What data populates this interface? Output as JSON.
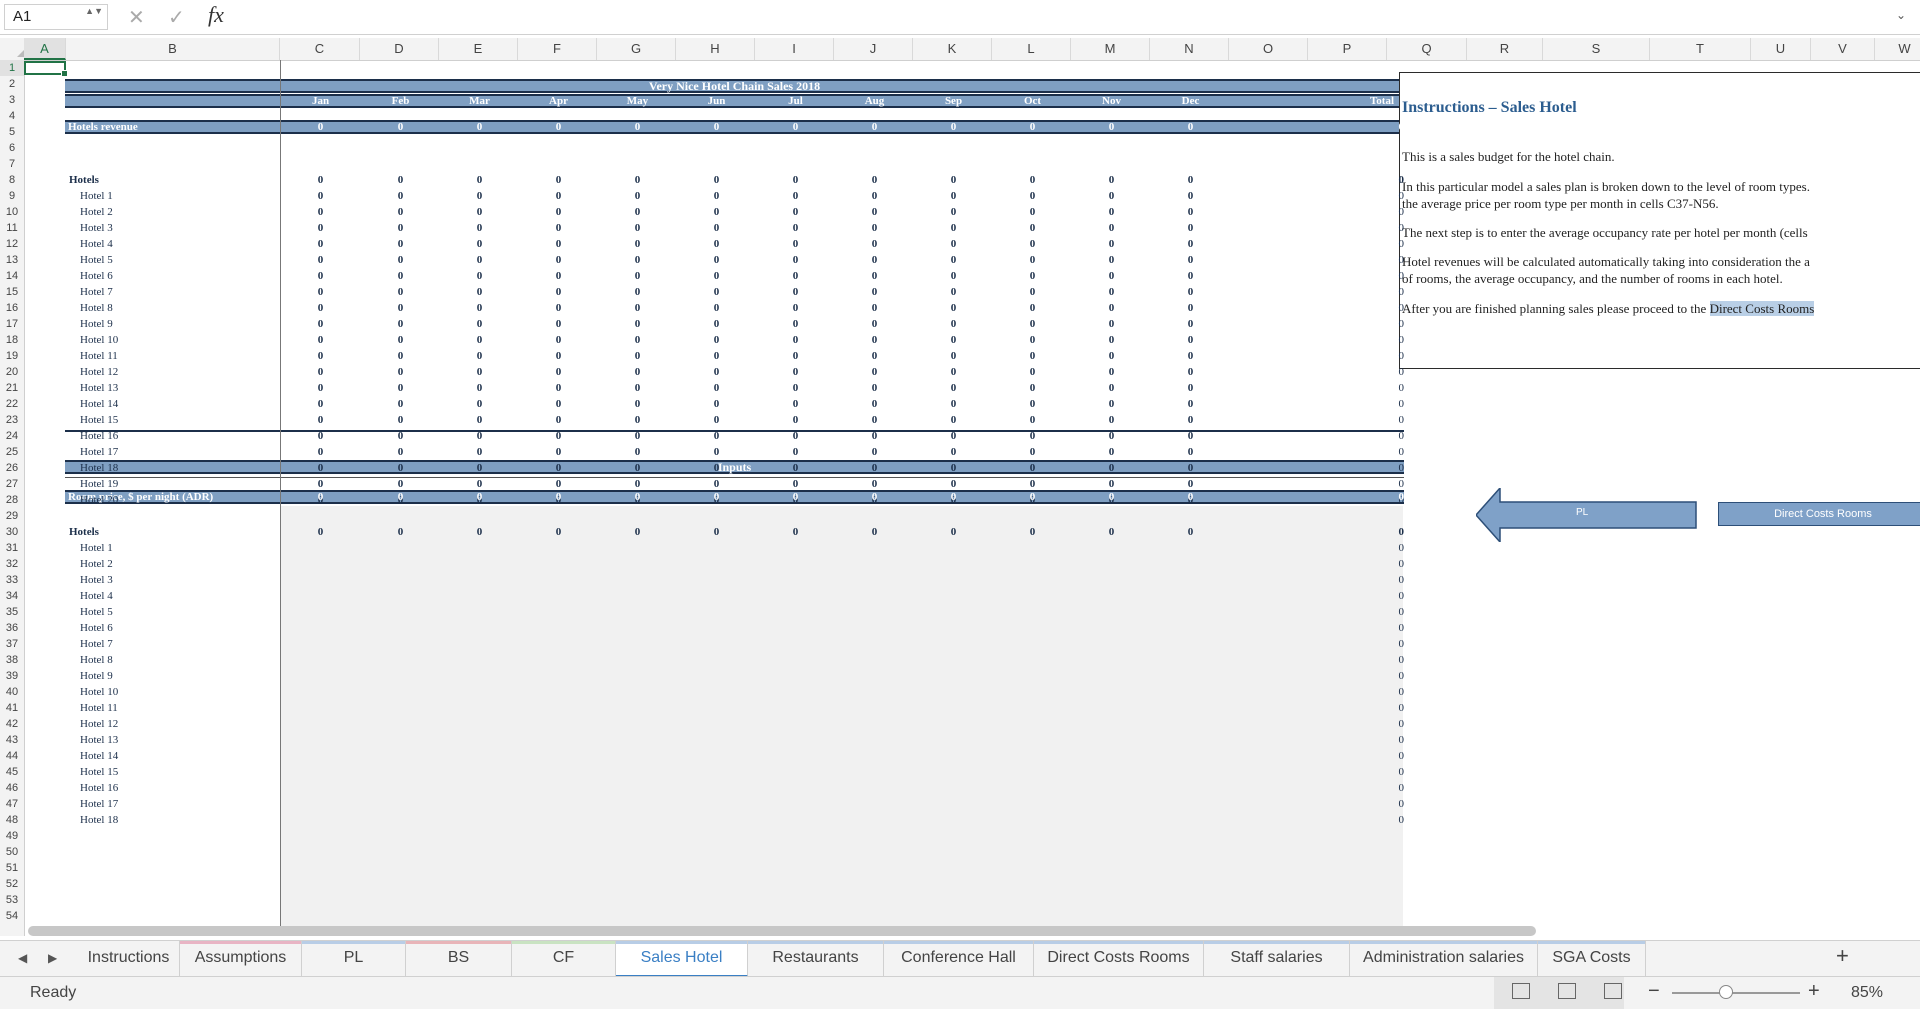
{
  "formula_bar": {
    "name_box": "A1",
    "namebox_arrows": "▲▼",
    "cancel_icon": "✕",
    "enter_icon": "✓",
    "fx_label": "fx",
    "formula": "",
    "dropdown_icon": "⌄"
  },
  "columns": [
    "A",
    "B",
    "C",
    "D",
    "E",
    "F",
    "G",
    "H",
    "I",
    "J",
    "K",
    "L",
    "M",
    "N",
    "O",
    "P",
    "Q",
    "R",
    "S",
    "T",
    "U",
    "V",
    "W"
  ],
  "rows": [
    "1",
    "2",
    "3",
    "4",
    "5",
    "6",
    "7",
    "8",
    "9",
    "10",
    "11",
    "12",
    "13",
    "14",
    "15",
    "16",
    "17",
    "18",
    "19",
    "20",
    "21",
    "22",
    "23",
    "24",
    "25",
    "26",
    "27",
    "28",
    "29",
    "30",
    "31",
    "32",
    "33",
    "34",
    "35",
    "36",
    "37",
    "38",
    "39",
    "40",
    "41",
    "42",
    "43",
    "44",
    "45",
    "46",
    "47",
    "48",
    "49",
    "50",
    "51",
    "52",
    "53",
    "54"
  ],
  "sheet": {
    "title": "Very Nice Hotel Chain Sales 2018",
    "months": [
      "Jan",
      "Feb",
      "Mar",
      "Apr",
      "May",
      "Jun",
      "Jul",
      "Aug",
      "Sep",
      "Oct",
      "Nov",
      "Dec"
    ],
    "total_label": "Total",
    "revenue_label": "Hotels revenue",
    "hotels_label": "Hotels",
    "hotels": [
      "Hotel 1",
      "Hotel 2",
      "Hotel 3",
      "Hotel 4",
      "Hotel 5",
      "Hotel 6",
      "Hotel 7",
      "Hotel 8",
      "Hotel 9",
      "Hotel 10",
      "Hotel 11",
      "Hotel 12",
      "Hotel 13",
      "Hotel 14",
      "Hotel 15",
      "Hotel 16",
      "Hotel 17",
      "Hotel 18",
      "Hotel 19",
      "Hotel 20"
    ],
    "zero": "0",
    "inputs_title": "Inputs",
    "room_price_label": "Room price, $ per night (ADR)",
    "inputs_hotels": [
      "Hotel 1",
      "Hotel 2",
      "Hotel 3",
      "Hotel 4",
      "Hotel 5",
      "Hotel 6",
      "Hotel 7",
      "Hotel 8",
      "Hotel 9",
      "Hotel 10",
      "Hotel 11",
      "Hotel 12",
      "Hotel 13",
      "Hotel 14",
      "Hotel 15",
      "Hotel 16",
      "Hotel 17",
      "Hotel 18"
    ]
  },
  "instructions": {
    "title": "Instructions – Sales Hotel",
    "p1": "This is a sales budget for the hotel chain.",
    "p2a": "In this particular model a sales plan is broken down to the level of room types.",
    "p2b": "the average price per room type per month in cells C37-N56.",
    "p3": "The next step is to enter the average occupancy rate per hotel per month (cells",
    "p4a": "Hotel revenues will be calculated automatically taking into consideration the a",
    "p4b": "of rooms, the average occupancy, and the number of rooms in each hotel.",
    "p5_pre": "After you are finished planning sales please proceed to the ",
    "p5_link": "Direct Costs Rooms"
  },
  "nav_buttons": {
    "pl": "PL",
    "direct_costs": "Direct Costs Rooms"
  },
  "tabs": [
    {
      "label": "Instructions",
      "stripe": ""
    },
    {
      "label": "Assumptions",
      "stripe": "#e8b4c4"
    },
    {
      "label": "PL",
      "stripe": "#b8cde6"
    },
    {
      "label": "BS",
      "stripe": "#e8b4b8"
    },
    {
      "label": "CF",
      "stripe": "#c9e3c2"
    },
    {
      "label": "Sales Hotel",
      "stripe": "#b8cde6",
      "active": true
    },
    {
      "label": "Restaurants",
      "stripe": "#b8cde6"
    },
    {
      "label": "Conference Hall",
      "stripe": "#b8cde6"
    },
    {
      "label": "Direct Costs Rooms",
      "stripe": "#b8cde6"
    },
    {
      "label": "Staff salaries",
      "stripe": "#b8cde6"
    },
    {
      "label": "Administration salaries",
      "stripe": "#b8cde6"
    },
    {
      "label": "SGA Costs",
      "stripe": "#b8cde6"
    }
  ],
  "tab_nav": {
    "prev": "◀",
    "next": "▶",
    "add": "+"
  },
  "status": {
    "text": "Ready",
    "zoom_minus": "−",
    "zoom_plus": "+",
    "zoom": "85%",
    "zoom_value": 0.42
  },
  "colors": {
    "band": "#7f9fc2",
    "border_dark": "#1c2f4a",
    "accent": "#217346",
    "active_tab": "#3a7fc4"
  }
}
